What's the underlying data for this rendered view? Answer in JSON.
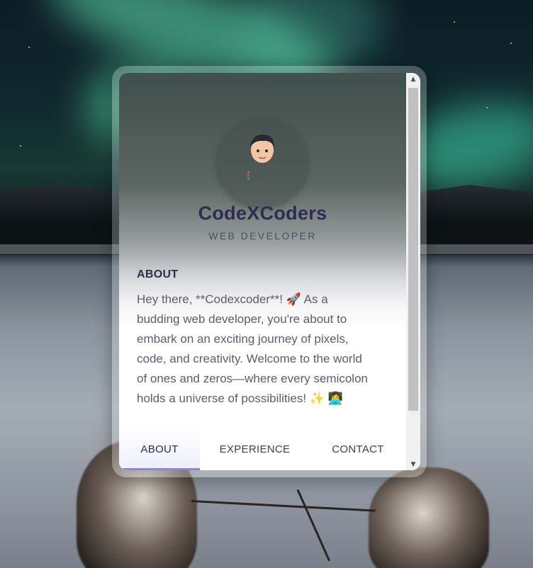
{
  "profile": {
    "name": "CodeXCoders",
    "role": "WEB DEVELOPER"
  },
  "about": {
    "heading": "ABOUT",
    "text": "Hey there, **Codexcoder**! 🚀 As a budding web developer, you're about to embark on an exciting journey of pixels, code, and creativity. Welcome to the world of ones and zeros—where every semicolon holds a universe of possibilities! ✨ 👩‍💻"
  },
  "tabs": [
    {
      "label": "ABOUT",
      "active": true
    },
    {
      "label": "EXPERIENCE",
      "active": false
    },
    {
      "label": "CONTACT",
      "active": false
    }
  ],
  "icons": {
    "scroll_up": "scroll-up-arrow",
    "scroll_down": "scroll-down-arrow",
    "avatar": "memoji-avatar"
  },
  "colors": {
    "name": "#2b2d52",
    "accent": "#8c80f0"
  }
}
